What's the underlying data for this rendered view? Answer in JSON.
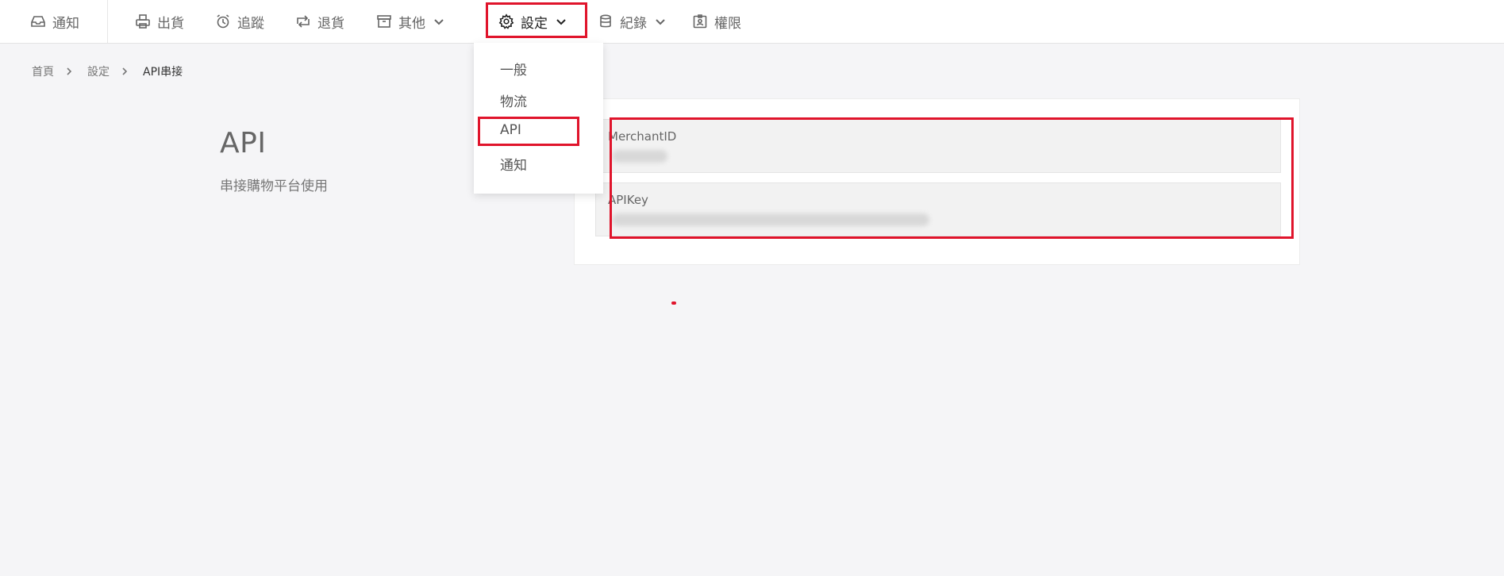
{
  "nav": {
    "items": [
      {
        "label": "通知",
        "icon": "inbox-icon"
      },
      {
        "label": "出貨",
        "icon": "printer-icon"
      },
      {
        "label": "追蹤",
        "icon": "alarm-clock-icon"
      },
      {
        "label": "退貨",
        "icon": "return-arrows-icon"
      },
      {
        "label": "其他",
        "icon": "archive-box-icon"
      },
      {
        "label": "設定",
        "icon": "gear-icon"
      },
      {
        "label": "紀錄",
        "icon": "database-icon"
      },
      {
        "label": "權限",
        "icon": "id-badge-icon"
      }
    ],
    "active": "設定"
  },
  "dropdown": {
    "items": [
      "一般",
      "物流",
      "API",
      "通知"
    ],
    "selected": "API"
  },
  "breadcrumb": [
    "首頁",
    "設定",
    "API串接"
  ],
  "section": {
    "title": "API",
    "description": "串接購物平台使用"
  },
  "fields": [
    {
      "label": "MerchantID",
      "value": ""
    },
    {
      "label": "APIKey",
      "value": ""
    }
  ],
  "colors": {
    "annotation": "#e0142b",
    "background": "#f5f5f7"
  }
}
